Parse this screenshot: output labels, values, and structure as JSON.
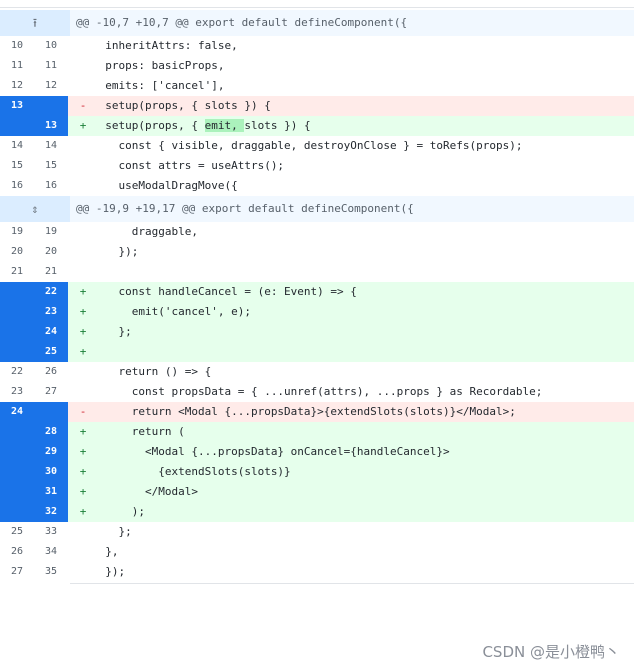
{
  "hunks": [
    {
      "header": "@@ -10,7 +10,7 @@ export default defineComponent({",
      "expand_icon": "expand-up-icon"
    },
    {
      "header": "@@ -19,9 +19,17 @@ export default defineComponent({",
      "expand_icon": "expand-both-icon"
    }
  ],
  "lines": [
    {
      "type": "ctx",
      "old": "10",
      "new": "10",
      "text": "inheritAttrs: false,"
    },
    {
      "type": "ctx",
      "old": "11",
      "new": "11",
      "text": "props: basicProps,"
    },
    {
      "type": "ctx",
      "old": "12",
      "new": "12",
      "text": "emits: ['cancel'],"
    },
    {
      "type": "del",
      "old": "13",
      "new": "",
      "sign": "-",
      "text": "setup(props, { slots }) {"
    },
    {
      "type": "add",
      "old": "",
      "new": "13",
      "sign": "+",
      "text_before": "setup(props, { ",
      "text_hl": "emit, ",
      "text_after": "slots }) {"
    },
    {
      "type": "ctx",
      "old": "14",
      "new": "14",
      "text": "  const { visible, draggable, destroyOnClose } = toRefs(props);"
    },
    {
      "type": "ctx",
      "old": "15",
      "new": "15",
      "text": "  const attrs = useAttrs();"
    },
    {
      "type": "ctx",
      "old": "16",
      "new": "16",
      "text": "  useModalDragMove({"
    },
    {
      "type": "ctx",
      "old": "19",
      "new": "19",
      "text": "    draggable,"
    },
    {
      "type": "ctx",
      "old": "20",
      "new": "20",
      "text": "  });"
    },
    {
      "type": "ctx",
      "old": "21",
      "new": "21",
      "text": ""
    },
    {
      "type": "add",
      "old": "",
      "new": "22",
      "sign": "+",
      "text": "  const handleCancel = (e: Event) => {"
    },
    {
      "type": "add",
      "old": "",
      "new": "23",
      "sign": "+",
      "text": "    emit('cancel', e);"
    },
    {
      "type": "add",
      "old": "",
      "new": "24",
      "sign": "+",
      "text": "  };"
    },
    {
      "type": "add",
      "old": "",
      "new": "25",
      "sign": "+",
      "text": ""
    },
    {
      "type": "ctx",
      "old": "22",
      "new": "26",
      "text": "  return () => {"
    },
    {
      "type": "ctx",
      "old": "23",
      "new": "27",
      "text": "    const propsData = { ...unref(attrs), ...props } as Recordable;"
    },
    {
      "type": "del",
      "old": "24",
      "new": "",
      "sign": "-",
      "text": "    return <Modal {...propsData}>{extendSlots(slots)}</Modal>;"
    },
    {
      "type": "add",
      "old": "",
      "new": "28",
      "sign": "+",
      "text": "    return ("
    },
    {
      "type": "add",
      "old": "",
      "new": "29",
      "sign": "+",
      "text": "      <Modal {...propsData} onCancel={handleCancel}>"
    },
    {
      "type": "add",
      "old": "",
      "new": "30",
      "sign": "+",
      "text": "        {extendSlots(slots)}"
    },
    {
      "type": "add",
      "old": "",
      "new": "31",
      "sign": "+",
      "text": "      </Modal>"
    },
    {
      "type": "add",
      "old": "",
      "new": "32",
      "sign": "+",
      "text": "    );"
    },
    {
      "type": "ctx",
      "old": "25",
      "new": "33",
      "text": "  };"
    },
    {
      "type": "ctx",
      "old": "26",
      "new": "34",
      "text": "},"
    },
    {
      "type": "ctx",
      "old": "27",
      "new": "35",
      "text": "});"
    }
  ],
  "watermark": "CSDN @是小橙鸭丶",
  "colors": {
    "added_bg": "#e6ffec",
    "removed_bg": "#ffebe9",
    "changed_gutter": "#1a73e8",
    "hunk_bg": "#f1f8ff"
  }
}
